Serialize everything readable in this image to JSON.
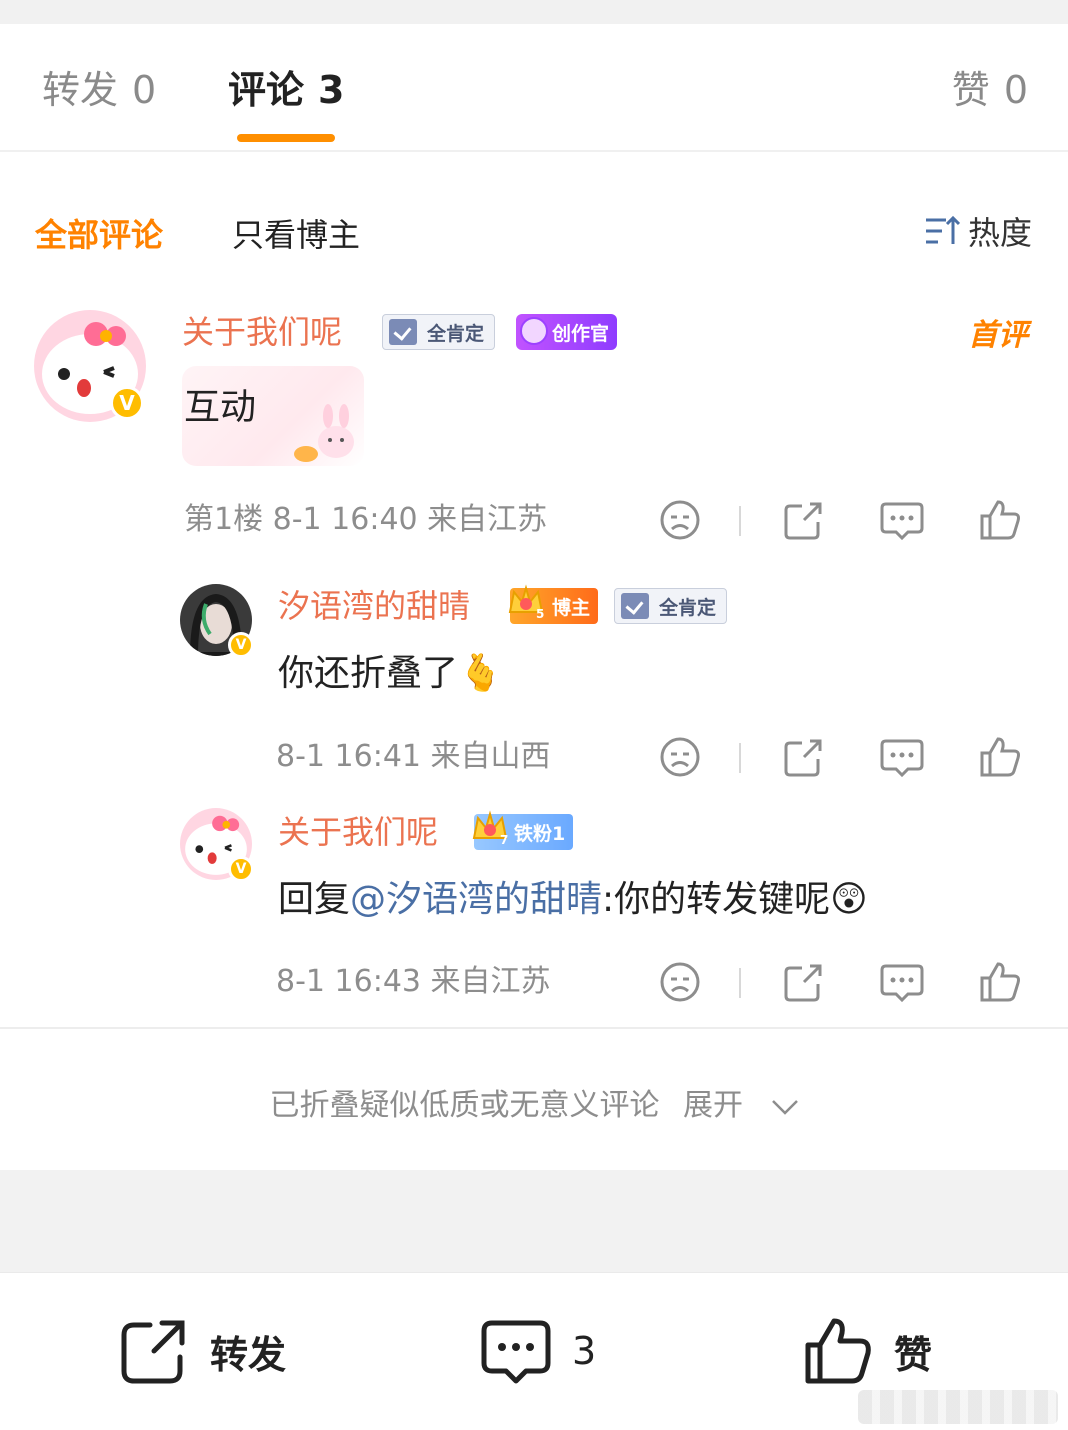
{
  "tabs": {
    "repost_label": "转发",
    "repost_count": "0",
    "comments_label": "评论",
    "comments_count": "3",
    "likes_label": "赞",
    "likes_count": "0"
  },
  "filter": {
    "all": "全部评论",
    "owner_only": "只看博主",
    "sort": "热度"
  },
  "comments": [
    {
      "name": "关于我们呢",
      "badges": [
        "全肯定",
        "创作官"
      ],
      "tag": "首评",
      "content": "互动",
      "meta": "第1楼 8-1 16:40 来自江苏",
      "avatar": "hello-kitty-avatar"
    },
    {
      "name": "汐语湾的甜晴",
      "badges": [
        "博主",
        "全肯定"
      ],
      "crown_level": "5",
      "content": "你还折叠了🫰",
      "meta": "8-1 16:41 来自山西",
      "avatar": "girl-avatar"
    },
    {
      "name": "关于我们呢",
      "badges": [
        "铁粉1"
      ],
      "crown_level": "7",
      "reply_prefix": "回复",
      "mention": "@汐语湾的甜晴",
      "content": ":你的转发键呢😲",
      "meta": "8-1 16:43 来自江苏",
      "avatar": "hello-kitty-avatar"
    }
  ],
  "folded": {
    "text": "已折叠疑似低质或无意义评论",
    "expand": "展开"
  },
  "bottom_bar": {
    "repost": "转发",
    "comment_count": "3",
    "like": "赞"
  },
  "colors": {
    "accent": "#ff8200",
    "username": "#eb7350",
    "mention": "#4a6fa5",
    "meta": "#8d8d8d"
  }
}
